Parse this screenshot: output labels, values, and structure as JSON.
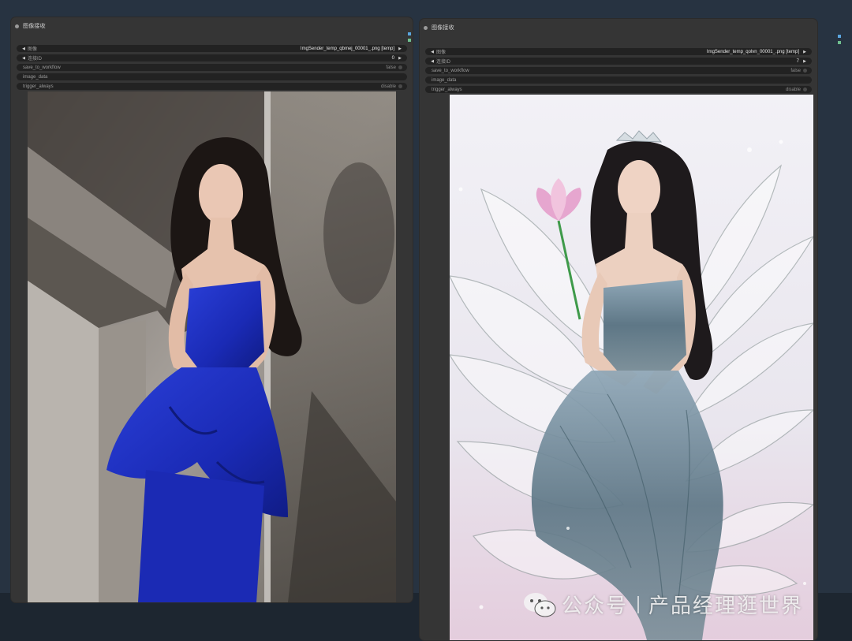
{
  "colors": {
    "canvas_bg": "#273341",
    "node_bg": "#353535",
    "widget_bg": "#222222",
    "slot_blue": "#5aa6e0",
    "slot_green": "#6fbf8f"
  },
  "nodes": [
    {
      "title": "图像接收",
      "widgets": {
        "image": {
          "label": "图像",
          "value": "ImgSender_temp_qbmej_00001_.png [temp]"
        },
        "link_id": {
          "label": "连接ID",
          "value": "0"
        },
        "save_to_workflow": {
          "label": "save_to_workflow",
          "value": "false"
        },
        "image_data": {
          "label": "image_data"
        },
        "trigger_always": {
          "label": "trigger_always",
          "value": "disable"
        }
      }
    },
    {
      "title": "图像接收",
      "widgets": {
        "image": {
          "label": "图像",
          "value": "ImgSender_temp_qolvn_00001_.png [temp]"
        },
        "link_id": {
          "label": "连接ID",
          "value": "7"
        },
        "save_to_workflow": {
          "label": "save_to_workflow",
          "value": "false"
        },
        "image_data": {
          "label": "image_data"
        },
        "trigger_always": {
          "label": "trigger_always",
          "value": "disable"
        }
      }
    }
  ],
  "icons": {
    "arrow_left": "◀",
    "arrow_right": "▶",
    "wechat": "wechat-icon"
  },
  "watermark": {
    "part1": "公众号",
    "part2": "产品经理逛世界"
  }
}
